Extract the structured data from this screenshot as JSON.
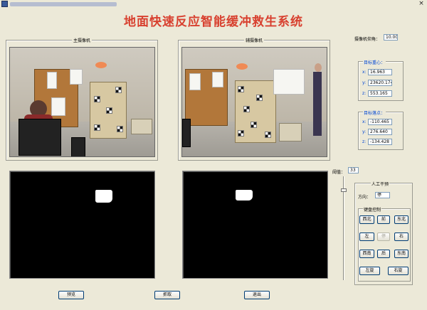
{
  "window": {
    "close_glyph": "×"
  },
  "app_title": "地面快速反应智能缓冲救生系统",
  "cameras": {
    "main_label": "主摄像机",
    "aux_label": "辅摄像机"
  },
  "camera_angle": {
    "label": "摄像机仰角：",
    "value": "10.00"
  },
  "target_center": {
    "title": "目标重心：",
    "x_label": "x:",
    "x_value": "16.963",
    "y_label": "y:",
    "y_value": "23620.174",
    "z_label": "z:",
    "z_value": "553.165"
  },
  "target_landing": {
    "title": "目标落点：",
    "x_label": "x:",
    "x_value": "-110.465",
    "y_label": "y:",
    "y_value": "276.640",
    "z_label": "z:",
    "z_value": "-134.428"
  },
  "threshold": {
    "label": "阈值：",
    "value": "33"
  },
  "manual": {
    "title": "人工干预",
    "direction_label": "方向：",
    "direction_value": "停",
    "keyboard_title": "键盘控制",
    "buttons": {
      "nw": "西北",
      "n": "前",
      "ne": "东北",
      "w": "左",
      "stop": "停",
      "e": "右",
      "sw": "西南",
      "s": "后",
      "se": "东南",
      "rot_left": "左旋",
      "rot_right": "右旋"
    }
  },
  "bottom_buttons": {
    "preview": "预览",
    "capture": "抓取",
    "exit": "退出"
  },
  "sliders": {
    "threshold_level": 0.12
  }
}
